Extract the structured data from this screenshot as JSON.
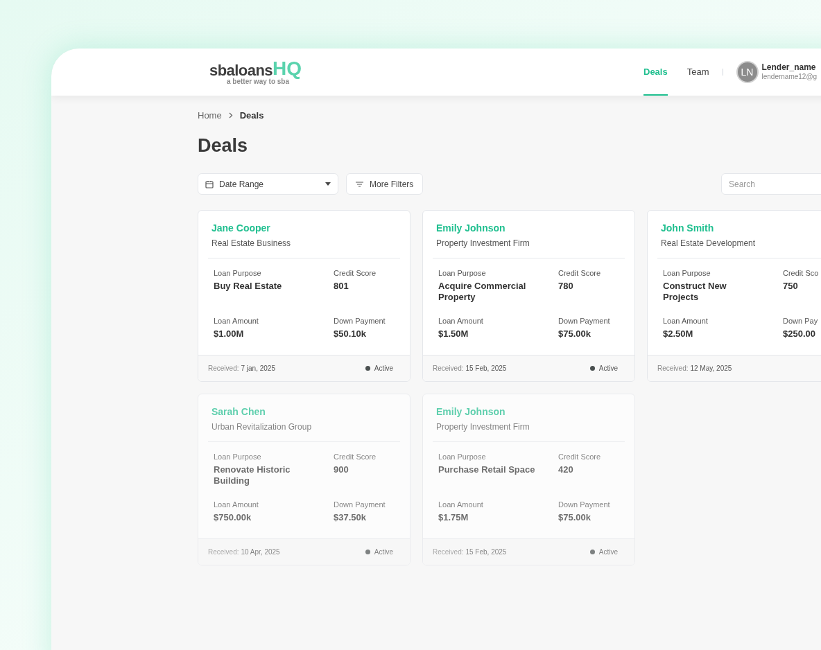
{
  "header": {
    "logo": {
      "word": "sbaloans",
      "accent": "HQ",
      "tagline": "a better way to sba"
    },
    "nav": [
      {
        "label": "Deals",
        "selected": true
      },
      {
        "label": "Team",
        "selected": false
      }
    ],
    "user": {
      "initials": "LN",
      "name": "Lender_name",
      "email": "lendername12@g"
    }
  },
  "breadcrumb": [
    {
      "label": "Home",
      "current": false
    },
    {
      "label": "Deals",
      "current": true
    }
  ],
  "title": "Deals",
  "filters": {
    "date_range": "Date Range",
    "more_filters": "More Filters",
    "search": {
      "placeholder": "Search"
    }
  },
  "deals": [
    {
      "name": "Jane Cooper",
      "company": "Real Estate Business",
      "fields": [
        {
          "label": "Loan Purpose",
          "value": "Buy Real Estate"
        },
        {
          "label": "Credit Score",
          "value": "801"
        },
        {
          "label": "Loan Amount",
          "value": "$1.00M"
        },
        {
          "label": "Down Payment",
          "value": "$50.10k"
        }
      ],
      "received_label": "Received:",
      "received": "7 jan, 2025",
      "status": "Active"
    },
    {
      "name": "Emily Johnson",
      "company": "Property Investment Firm",
      "fields": [
        {
          "label": "Loan Purpose",
          "value": "Acquire Commercial Property"
        },
        {
          "label": "Credit Score",
          "value": "780"
        },
        {
          "label": "Loan Amount",
          "value": "$1.50M"
        },
        {
          "label": "Down Payment",
          "value": "$75.00k"
        }
      ],
      "received_label": "Received:",
      "received": "15 Feb, 2025",
      "status": "Active"
    },
    {
      "name": "John Smith",
      "company": "Real Estate Development",
      "fields": [
        {
          "label": "Loan Purpose",
          "value": "Construct New Projects"
        },
        {
          "label": "Credit Sco",
          "value": "750"
        },
        {
          "label": "Loan Amount",
          "value": "$2.50M"
        },
        {
          "label": "Down Pay",
          "value": "$250.00"
        }
      ],
      "received_label": "Received:",
      "received": "12 May, 2025"
    },
    {
      "name": "Sarah Chen",
      "company": "Urban Revitalization Group",
      "fields": [
        {
          "label": "Loan Purpose",
          "value": "Renovate Historic Building"
        },
        {
          "label": "Credit Score",
          "value": "900"
        },
        {
          "label": "Loan Amount",
          "value": "$750.00k"
        },
        {
          "label": "Down Payment",
          "value": "$37.50k"
        }
      ],
      "received_label": "Received:",
      "received": "10 Apr, 2025",
      "status": "Active"
    },
    {
      "name": "Emily Johnson",
      "company": "Property Investment Firm",
      "fields": [
        {
          "label": "Loan Purpose",
          "value": "Purchase Retail Space"
        },
        {
          "label": "Credit Score",
          "value": "420"
        },
        {
          "label": "Loan Amount",
          "value": "$1.75M"
        },
        {
          "label": "Down Payment",
          "value": "$75.00k"
        }
      ],
      "received_label": "Received:",
      "received": "15 Feb, 2025",
      "status": "Active"
    }
  ]
}
